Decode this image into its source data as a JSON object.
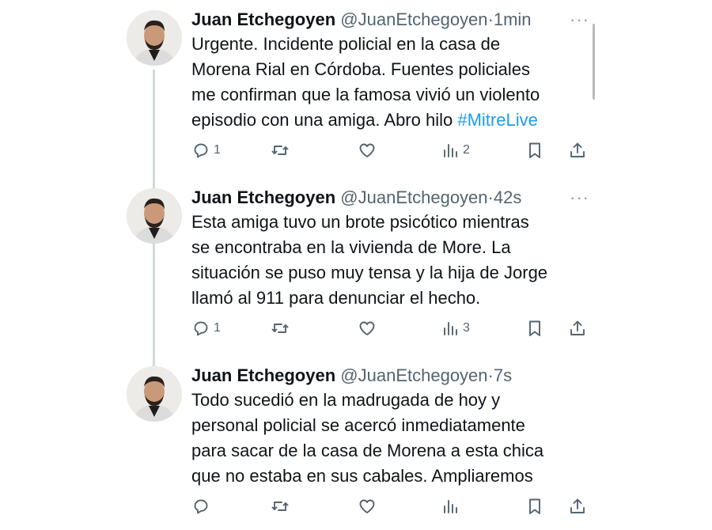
{
  "colors": {
    "link": "#1d9bf0",
    "text": "#0f1419",
    "muted": "#536471",
    "thread_line": "#cfd9de"
  },
  "tweets": [
    {
      "name": "Juan Etchegoyen",
      "handle": "@JuanEtchegoyen",
      "dot": "·",
      "time": "1min",
      "more": "···",
      "text": "Urgente. Incidente policial en la casa de\nMorena Rial en Córdoba. Fuentes policiales\nme confirman que la famosa vivió un violento\nepisodio con una amiga. Abro hilo ",
      "hashtag": "#MitreLive",
      "replies": "1",
      "retweets": "",
      "likes": "",
      "views": "2"
    },
    {
      "name": "Juan Etchegoyen",
      "handle": "@JuanEtchegoyen",
      "dot": "·",
      "time": "42s",
      "more": "···",
      "text": "Esta amiga tuvo un brote psicótico mientras\nse encontraba en la vivienda de More. La\nsituación se puso muy tensa y la hija de Jorge\nllamó al 911 para denunciar el hecho.",
      "hashtag": "",
      "replies": "1",
      "retweets": "",
      "likes": "",
      "views": "3"
    },
    {
      "name": "Juan Etchegoyen",
      "handle": "@JuanEtchegoyen",
      "dot": "·",
      "time": "7s",
      "more": "",
      "text": "Todo sucedió en la madrugada de hoy y\npersonal policial se acercó inmediatamente\npara sacar de la casa de Morena a esta chica\nque no estaba en sus cabales. Ampliaremos",
      "hashtag": "",
      "replies": "",
      "retweets": "",
      "likes": "",
      "views": ""
    }
  ],
  "icons": [
    "reply-icon",
    "retweet-icon",
    "like-icon",
    "views-icon",
    "bookmark-icon",
    "share-icon"
  ]
}
